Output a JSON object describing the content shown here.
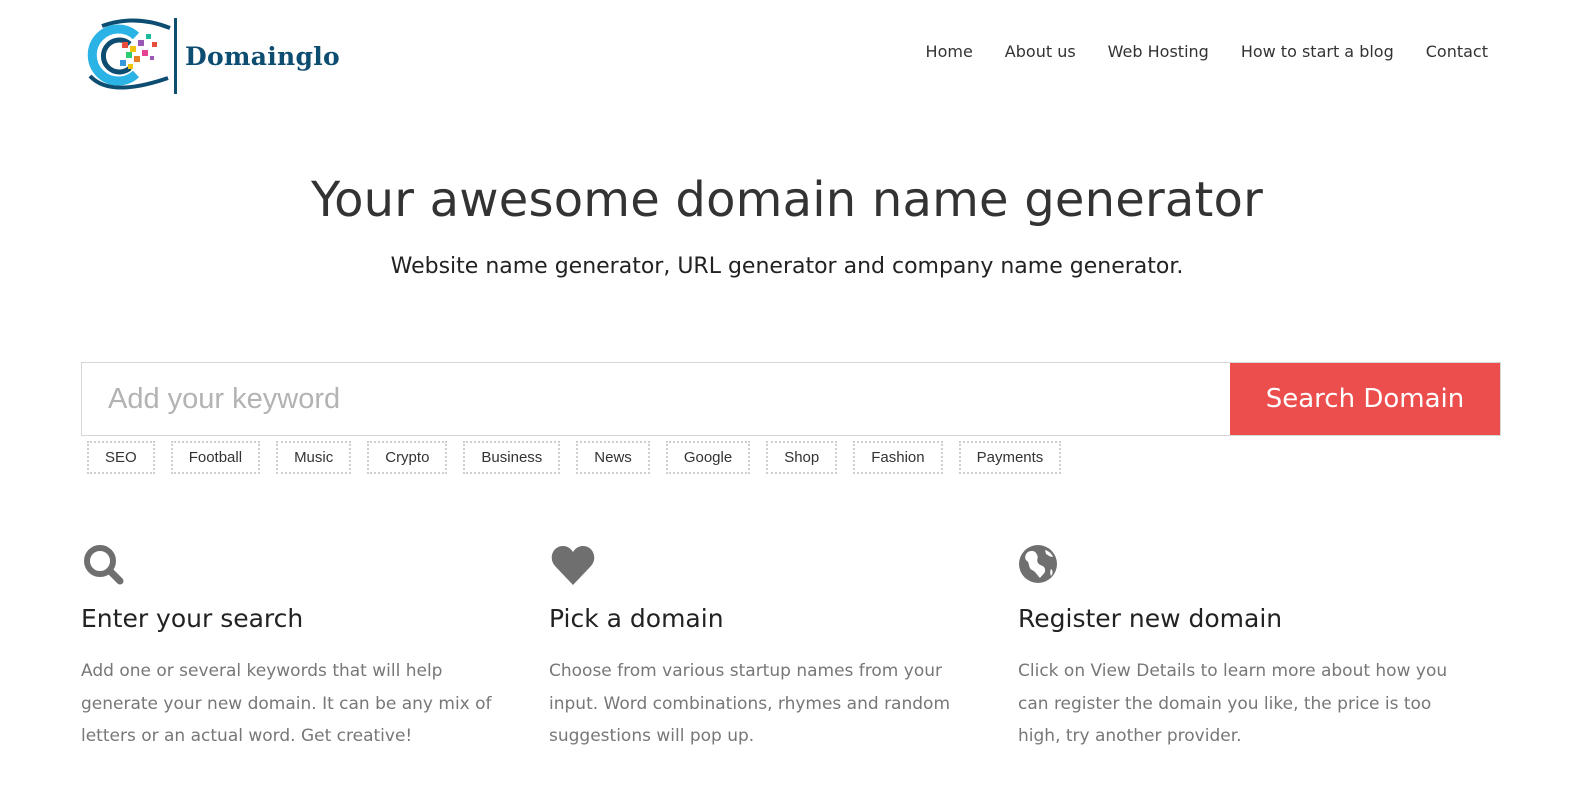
{
  "brand": {
    "name": "Domainglo",
    "color": "#0e4d72"
  },
  "nav": {
    "items": [
      {
        "label": "Home"
      },
      {
        "label": "About us"
      },
      {
        "label": "Web Hosting"
      },
      {
        "label": "How to start a blog"
      },
      {
        "label": "Contact"
      }
    ]
  },
  "hero": {
    "title": "Your awesome domain name generator",
    "subtitle": "Website name generator, URL generator and company name generator."
  },
  "search": {
    "placeholder": "Add your keyword",
    "value": "",
    "button_label": "Search Domain",
    "button_color": "#ec4d4d"
  },
  "keywords": [
    "SEO",
    "Football",
    "Music",
    "Crypto",
    "Business",
    "News",
    "Google",
    "Shop",
    "Fashion",
    "Payments"
  ],
  "features": [
    {
      "icon": "search-icon",
      "title": "Enter your search",
      "text": "Add one or several keywords that will help generate your new domain. It can be any mix of letters or an actual word. Get creative!"
    },
    {
      "icon": "heart-icon",
      "title": "Pick a domain",
      "text": "Choose from various startup names from your input. Word combinations, rhymes and random suggestions will pop up."
    },
    {
      "icon": "globe-icon",
      "title": "Register new domain",
      "text": "Click on View Details to learn more about how you can register the domain you like, the price is too high, try another provider."
    }
  ]
}
